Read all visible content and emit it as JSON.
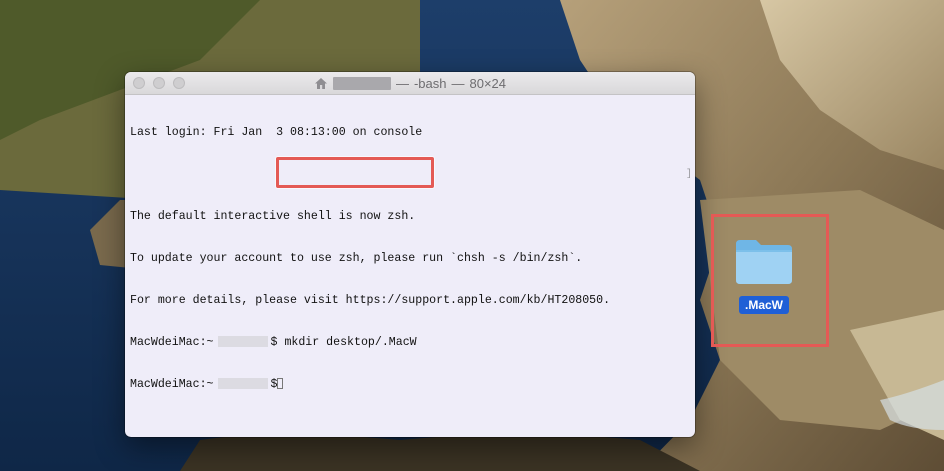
{
  "window": {
    "title_separator_left": "—",
    "title_process": "-bash",
    "title_separator_right": "—",
    "title_size": "80×24"
  },
  "terminal": {
    "line1": "Last login: Fri Jan  3 08:13:00 on console",
    "line2": "",
    "line3": "The default interactive shell is now zsh.",
    "line4": "To update your account to use zsh, please run `chsh -s /bin/zsh`.",
    "line5": "For more details, please visit https://support.apple.com/kb/HT208050.",
    "prompt_host": "MacWdeiMac:~",
    "prompt_symbol": "$",
    "command": "mkdir desktop/.MacW",
    "scroll_marker": "]"
  },
  "desktop": {
    "folder_label": ".MacW"
  },
  "colors": {
    "highlight": "#e45a55",
    "terminal_bg": "#efedf9",
    "folder_selection": "#1f5fd6"
  },
  "icons": [
    "home-icon",
    "folder-icon",
    "close-button",
    "minimize-button",
    "zoom-button"
  ]
}
